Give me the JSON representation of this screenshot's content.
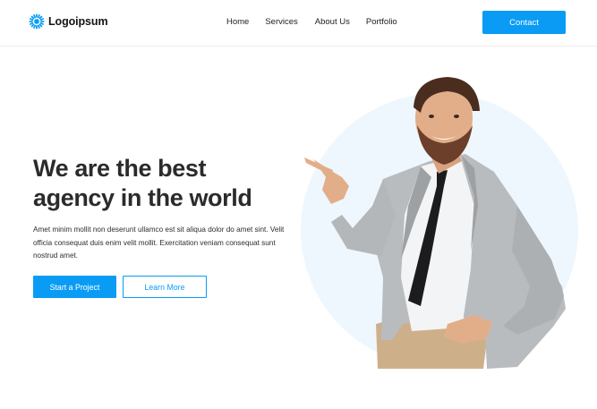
{
  "header": {
    "logo_text": "Logoipsum",
    "logo_icon": "sunburst-logo-icon",
    "nav": [
      "Home",
      "Services",
      "About Us",
      "Portfolio"
    ],
    "contact_label": "Contact"
  },
  "hero": {
    "headline_line1": "We are the best",
    "headline_line2": "agency in the world",
    "description": "Amet minim mollit non deserunt ullamco est sit aliqua dolor do amet sint. Velit officia consequat duis enim velit mollit. Exercitation veniam consequat sunt nostrud amet.",
    "primary_button": "Start a Project",
    "secondary_button": "Learn More"
  },
  "colors": {
    "accent": "#0a9cf5",
    "circle": "#eef7fd",
    "headline": "#2b2b2b"
  }
}
